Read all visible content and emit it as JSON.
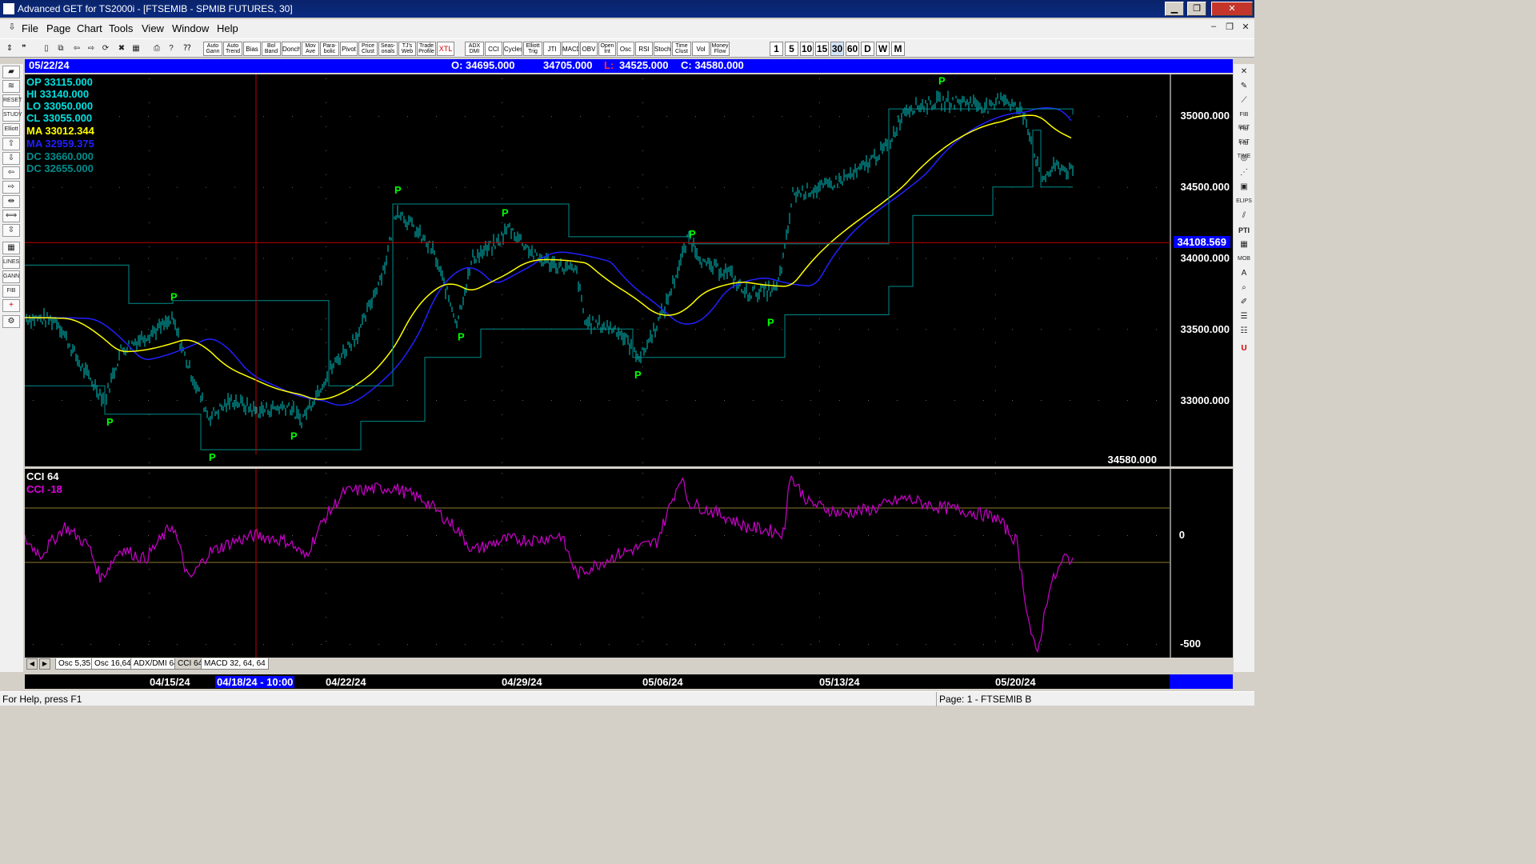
{
  "window": {
    "title": "Advanced GET for TS2000i - [FTSEMIB - SPMIB FUTURES, 30]",
    "min": "▁",
    "max": "❐",
    "close": "✕"
  },
  "menu": {
    "items": [
      "File",
      "Page",
      "Chart",
      "Tools",
      "View",
      "Window",
      "Help"
    ]
  },
  "toolbar": {
    "study_buttons": [
      "Auto Gann",
      "Auto Trend",
      "Bias",
      "Bol Band",
      "Donch",
      "Mov Ave",
      "Para-bolic",
      "Pivot",
      "Price Clust",
      "Seas-onals",
      "TJ's Web",
      "Trade Profile",
      "XTL",
      "ADX DMI",
      "CCI",
      "Cycles",
      "Elliott Trig",
      "JTI",
      "MACD",
      "OBV",
      "Open Int",
      "Osc",
      "RSI",
      "Stoch",
      "Time Clust",
      "Vol",
      "Money Flow"
    ],
    "period_buttons": [
      "1",
      "5",
      "10",
      "15",
      "30",
      "60",
      "D",
      "W",
      "M"
    ],
    "active_period": "30"
  },
  "datebar": {
    "date": "05/22/24",
    "open": "O: 34695.000",
    "high": "34705.000",
    "low_label": "L:",
    "low": "34525.000",
    "close": "C: 34580.000"
  },
  "legend": {
    "op": "OP  33115.000",
    "hi": "HI   33140.000",
    "lo": "LO  33050.000",
    "cl": "CL  33055.000",
    "ma1": "MA  33012.344",
    "ma2": "MA  32959.375",
    "dc1": "DC  33660.000",
    "dc2": "DC  32655.000"
  },
  "price_axis": {
    "labels": [
      "35000.000",
      "34500.000",
      "34000.000",
      "33500.000",
      "33000.000"
    ],
    "cursor": "34108.569",
    "last": "34580.000"
  },
  "cci_panel": {
    "title": "CCI 64",
    "value": "CCI  -18",
    "labels": [
      "0",
      "-500"
    ]
  },
  "tabs": [
    "Osc 5,35",
    "Osc 16,64",
    "ADX/DMI 64",
    "CCI 64",
    "MACD 32, 64, 64"
  ],
  "date_axis": {
    "labels": [
      "04/15/24",
      "04/22/24",
      "04/29/24",
      "05/06/24",
      "05/13/24",
      "05/20/24"
    ],
    "cursor": "04/18/24 - 10:00"
  },
  "pivot_label": "P",
  "status": {
    "help": "For Help, press F1",
    "page": "Page: 1 - FTSEMIB B"
  },
  "colors": {
    "background": "#000000",
    "price_bars": "#00c8c8",
    "moving_avg_fast": "#ffff00",
    "moving_avg_slow": "#2020ff",
    "donchian": "#008c8c",
    "pivots": "#00ff00",
    "cci": "#c000c0",
    "cursor": "#c00000",
    "header": "#0000ff"
  }
}
